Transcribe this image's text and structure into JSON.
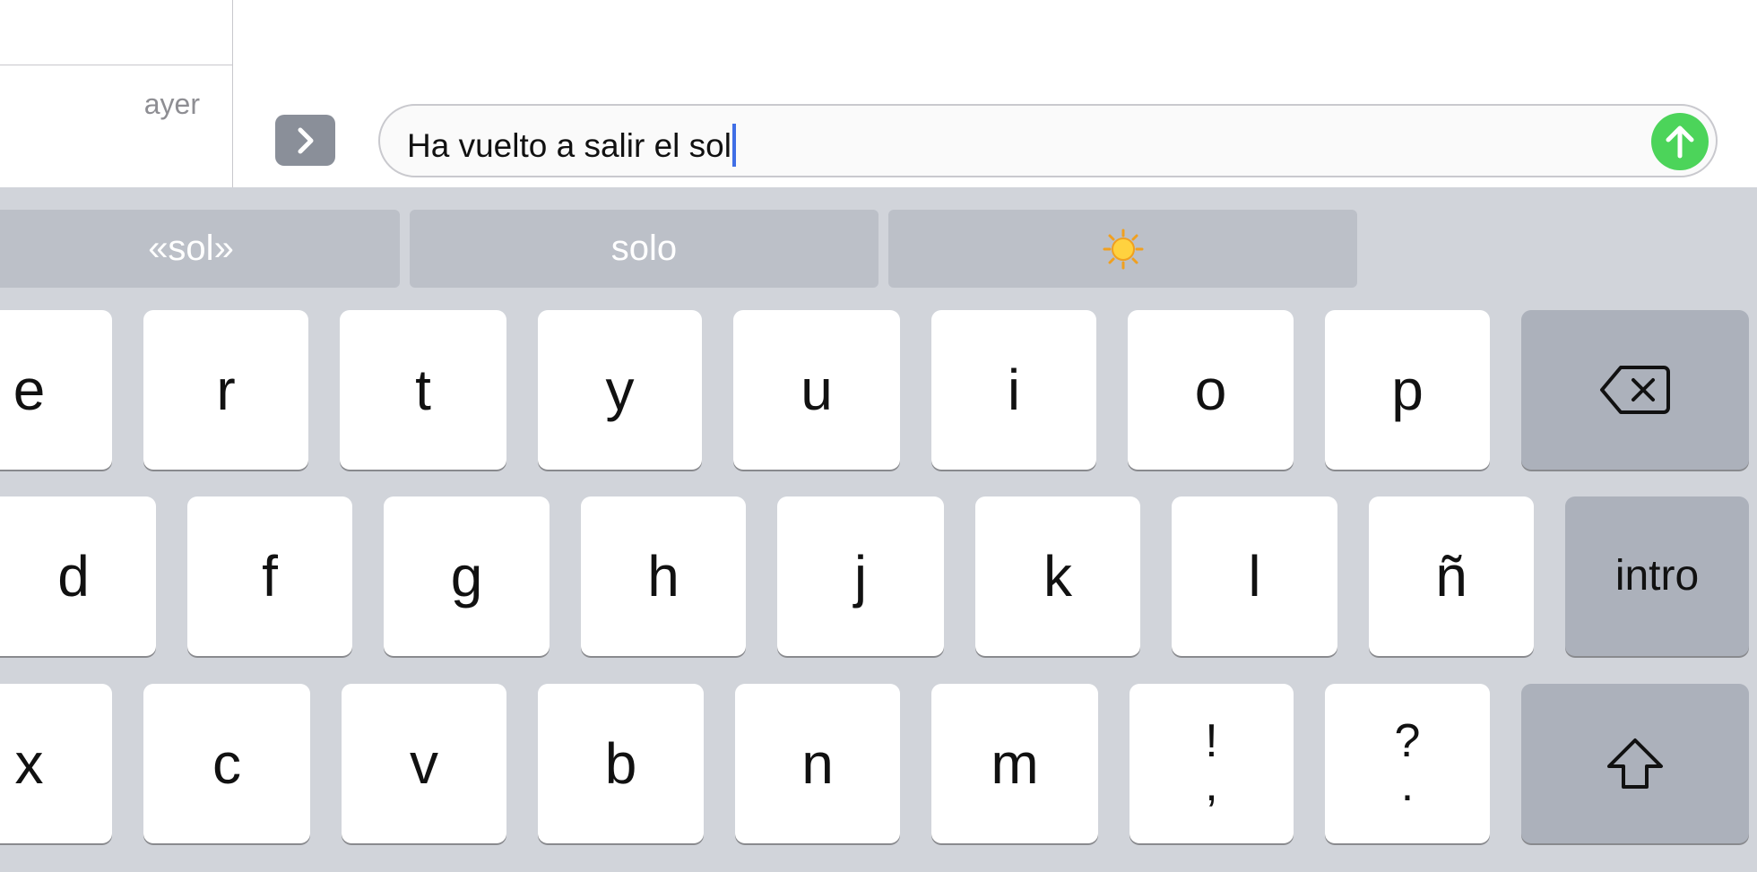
{
  "conversation": {
    "timestamp": "ayer"
  },
  "compose": {
    "text": "Ha vuelto a salir el sol",
    "expand_icon": "chevron-right-icon",
    "send_icon": "arrow-up-icon",
    "send_color": "#4cd45a"
  },
  "suggestions": [
    "«sol»",
    "solo",
    "☀️"
  ],
  "keys": {
    "row1": [
      "e",
      "r",
      "t",
      "y",
      "u",
      "i",
      "o",
      "p"
    ],
    "row2": [
      "d",
      "f",
      "g",
      "h",
      "j",
      "k",
      "l",
      "ñ"
    ],
    "row3": [
      "x",
      "c",
      "v",
      "b",
      "n",
      "m"
    ],
    "exclaim_top": "!",
    "exclaim_bottom": ",",
    "question_top": "?",
    "question_bottom": ".",
    "return_label": "intro",
    "backspace_icon": "backspace-icon",
    "shift_icon": "shift-icon"
  },
  "colors": {
    "keyboard_bg": "#d1d4da",
    "function_key": "#acb1bb",
    "caret": "#3f6ee6"
  }
}
